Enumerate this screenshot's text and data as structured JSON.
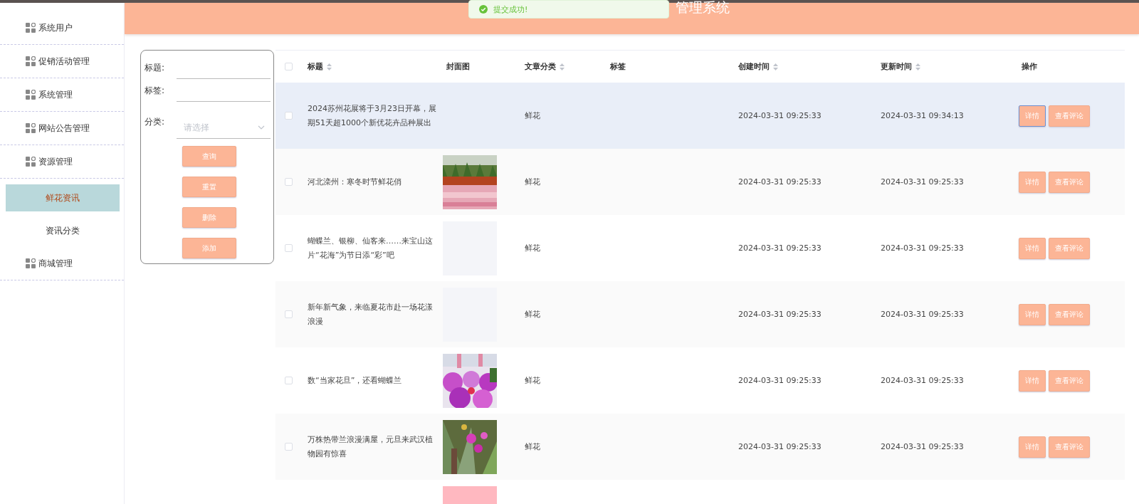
{
  "header": {
    "title": "管理系统"
  },
  "toast": {
    "message": "提交成功!",
    "kind": "success"
  },
  "sidebar": {
    "items": [
      {
        "label": "系统用户",
        "selected": false
      },
      {
        "label": "促销活动管理",
        "selected": false
      },
      {
        "label": "系统管理",
        "selected": false
      },
      {
        "label": "网站公告管理",
        "selected": false
      },
      {
        "label": "资源管理",
        "selected": false,
        "children": [
          {
            "label": "鲜花资讯",
            "selected": true
          },
          {
            "label": "资讯分类",
            "selected": false
          }
        ]
      },
      {
        "label": "商城管理",
        "selected": false
      }
    ]
  },
  "filter": {
    "fields": [
      {
        "label": "标题:",
        "kind": "input"
      },
      {
        "label": "标签:",
        "kind": "input"
      },
      {
        "label": "分类:",
        "kind": "select",
        "placeholder": "请选择"
      }
    ],
    "buttons": [
      "查询",
      "重置",
      "删除",
      "添加"
    ]
  },
  "table": {
    "all_checked": false,
    "columns": [
      {
        "label": "标题",
        "sortable": true
      },
      {
        "label": "封面图",
        "sortable": false
      },
      {
        "label": "文章分类",
        "sortable": true
      },
      {
        "label": "标签",
        "sortable": false
      },
      {
        "label": "创建时间",
        "sortable": true
      },
      {
        "label": "更新时间",
        "sortable": true
      },
      {
        "label": "操作",
        "sortable": false
      }
    ],
    "rows": [
      {
        "title": "2024苏州花展将于3月23日开幕，展期51天超1000个新优花卉品种展出",
        "cover": {
          "kind": "none"
        },
        "category": "鲜花",
        "created": "2024-03-31 09:25:33",
        "updated": "2024-03-31 09:34:13",
        "hovered": true,
        "actions": [
          {
            "label": "详情",
            "focused": true
          },
          {
            "label": "查看评论",
            "focused": false
          }
        ]
      },
      {
        "title": "河北滦州：寒冬时节鲜花俏",
        "cover": {
          "kind": "picture"
        },
        "category": "鲜花",
        "created": "2024-03-31 09:25:33",
        "updated": "2024-03-31 09:25:33",
        "hovered": false,
        "actions": [
          {
            "label": "详情",
            "focused": false
          },
          {
            "label": "查看评论",
            "focused": false
          }
        ]
      },
      {
        "title": "蝴蝶兰、银柳、仙客来……来宝山这片“花海”为节日添“彩”吧",
        "cover": {
          "kind": "blank",
          "color": "#f4f5f9"
        },
        "category": "鲜花",
        "created": "2024-03-31 09:25:33",
        "updated": "2024-03-31 09:25:33",
        "hovered": false,
        "actions": [
          {
            "label": "详情",
            "focused": false
          },
          {
            "label": "查看评论",
            "focused": false
          }
        ]
      },
      {
        "title": "新年新气象，来临夏花市赴一场花漾浪漫",
        "cover": {
          "kind": "blank",
          "color": "#f4f5f9"
        },
        "category": "鲜花",
        "created": "2024-03-31 09:25:33",
        "updated": "2024-03-31 09:25:33",
        "hovered": false,
        "actions": [
          {
            "label": "详情",
            "focused": false
          },
          {
            "label": "查看评论",
            "focused": false
          }
        ]
      },
      {
        "title": "数“当家花旦”，还看蝴蝶兰",
        "cover": {
          "kind": "picture"
        },
        "category": "鲜花",
        "created": "2024-03-31 09:25:33",
        "updated": "2024-03-31 09:25:33",
        "hovered": false,
        "actions": [
          {
            "label": "详情",
            "focused": false
          },
          {
            "label": "查看评论",
            "focused": false
          }
        ]
      },
      {
        "title": "万株热带兰浪漫满屋，元旦来武汉植物园有惊喜",
        "cover": {
          "kind": "picture"
        },
        "category": "鲜花",
        "created": "2024-03-31 09:25:33",
        "updated": "2024-03-31 09:25:33",
        "hovered": false,
        "actions": [
          {
            "label": "详情",
            "focused": false
          },
          {
            "label": "查看评论",
            "focused": false
          }
        ]
      },
      {
        "cover": {
          "kind": "blank",
          "color": "#ffb8c0"
        },
        "hovered": false
      }
    ]
  }
}
